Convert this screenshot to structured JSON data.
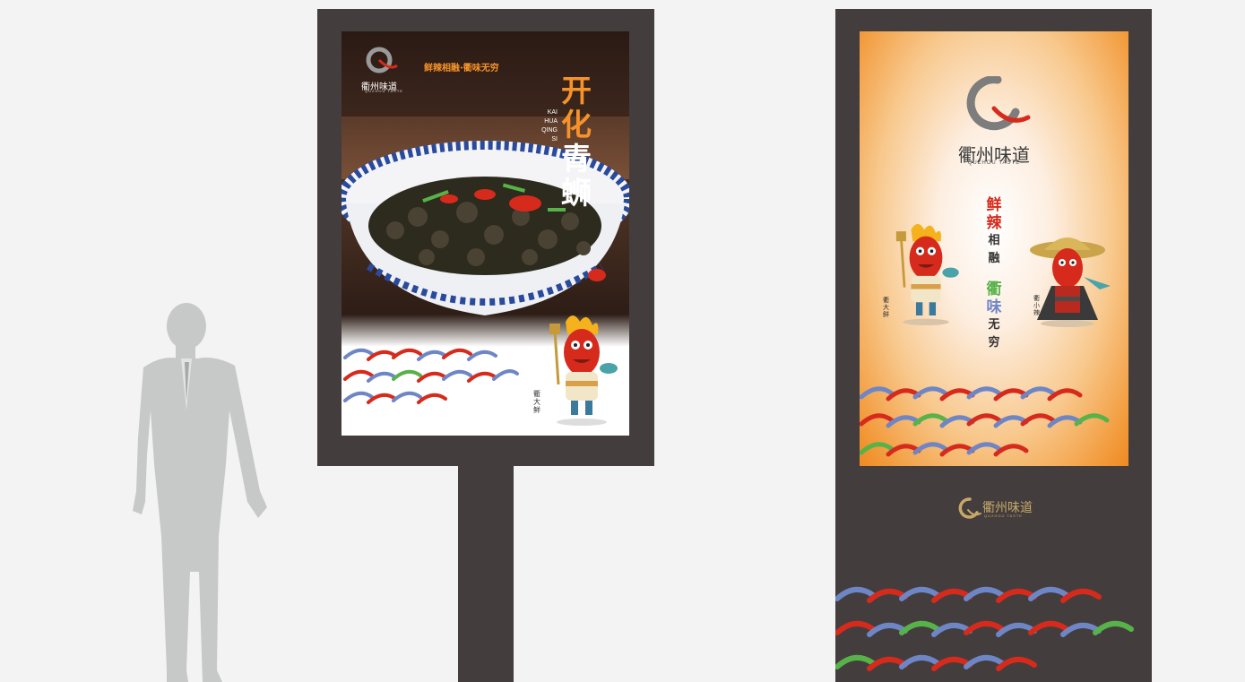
{
  "brand": {
    "name_cn": "衢州味道",
    "name_en": "QUZHOU TASTE",
    "accent_red": "#d62a1c",
    "accent_orange": "#f5932a",
    "accent_blue": "#6e86c6",
    "accent_green": "#58b24a",
    "frame_color": "#433e3d",
    "gold": "#c8a86a"
  },
  "left_sign": {
    "slogan_small": "鲜辣相融·衢味无穷",
    "dish_title_chars": [
      "开",
      "化",
      "青",
      "蛳"
    ],
    "dish_pinyin": [
      "KAI",
      "HUA",
      "QING",
      "SI"
    ],
    "mascot_name": "衢大鲜"
  },
  "right_sign": {
    "slogan_chars": [
      "鲜",
      "辣",
      "相",
      "融",
      "衢",
      "味",
      "无",
      "穷"
    ],
    "mascot_left_name": "衢大鲜",
    "mascot_right_name": "衢小辣"
  }
}
